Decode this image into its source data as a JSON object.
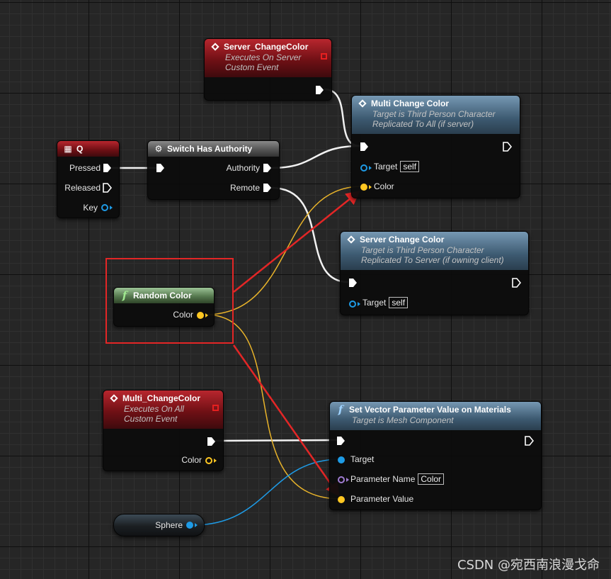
{
  "nodes": {
    "server_changecolor": {
      "title": "Server_ChangeColor",
      "sub1": "Executes On Server",
      "sub2": "Custom Event"
    },
    "multi_change_color": {
      "title": "Multi Change Color",
      "sub1": "Target is Third Person Character",
      "sub2": "Replicated To All (if server)",
      "target_label": "Target",
      "target_value": "self",
      "color_label": "Color"
    },
    "q_key": {
      "title": "Q",
      "pressed": "Pressed",
      "released": "Released",
      "key": "Key"
    },
    "switch_authority": {
      "title": "Switch Has Authority",
      "authority": "Authority",
      "remote": "Remote"
    },
    "server_change_color": {
      "title": "Server Change Color",
      "sub1": "Target is Third Person Character",
      "sub2": "Replicated To Server (if owning client)",
      "target_label": "Target",
      "target_value": "self"
    },
    "random_color": {
      "title": "Random Color",
      "color": "Color"
    },
    "multi_changecolor_event": {
      "title": "Multi_ChangeColor",
      "sub1": "Executes On All",
      "sub2": "Custom Event",
      "color": "Color"
    },
    "set_vector_param": {
      "title": "Set Vector Parameter Value on Materials",
      "sub1": "Target is Mesh Component",
      "target": "Target",
      "param_name_label": "Parameter Name",
      "param_name_value": "Color",
      "param_value": "Parameter Value"
    },
    "sphere": {
      "label": "Sphere"
    }
  },
  "colors": {
    "exec_wire": "#ffffff",
    "color_wire": "#e8b32a",
    "object_wire": "#1e9be6",
    "annotation_red": "#e32626"
  },
  "watermark": "CSDN @宛西南浪漫戈命"
}
